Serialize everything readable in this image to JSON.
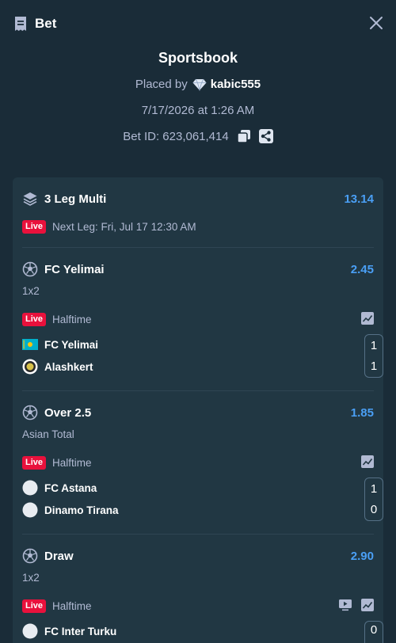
{
  "header": {
    "title": "Bet"
  },
  "summary": {
    "title": "Sportsbook",
    "placed_by_label": "Placed by",
    "username": "kabic555",
    "datetime": "7/17/2026 at 1:26 AM",
    "bet_id": "Bet ID: 623,061,414"
  },
  "multi": {
    "title": "3 Leg Multi",
    "odds": "13.14",
    "live_label": "Live",
    "next_leg": "Next Leg: Fri, Jul 17 12:30 AM"
  },
  "legs": [
    {
      "selection": "FC Yelimai",
      "odds": "2.45",
      "market": "1x2",
      "live_label": "Live",
      "status": "Halftime",
      "teams": [
        {
          "name": "FC Yelimai",
          "score": "1",
          "flag": "kazakhstan-flag"
        },
        {
          "name": "Alashkert",
          "score": "1",
          "flag": "alashkert-crest"
        }
      ]
    },
    {
      "selection": "Over 2.5",
      "odds": "1.85",
      "market": "Asian Total",
      "live_label": "Live",
      "status": "Halftime",
      "teams": [
        {
          "name": "FC Astana",
          "score": "1",
          "flag": "placeholder-circle"
        },
        {
          "name": "Dinamo Tirana",
          "score": "0",
          "flag": "placeholder-circle"
        }
      ]
    },
    {
      "selection": "Draw",
      "odds": "2.90",
      "market": "1x2",
      "live_label": "Live",
      "status": "Halftime",
      "teams": [
        {
          "name": "FC Inter Turku",
          "score": "0",
          "flag": "placeholder-circle"
        }
      ]
    }
  ],
  "colors": {
    "background": "#1a2c38",
    "card": "#213743",
    "odds": "#4a9ff5",
    "live": "#e9113c"
  }
}
